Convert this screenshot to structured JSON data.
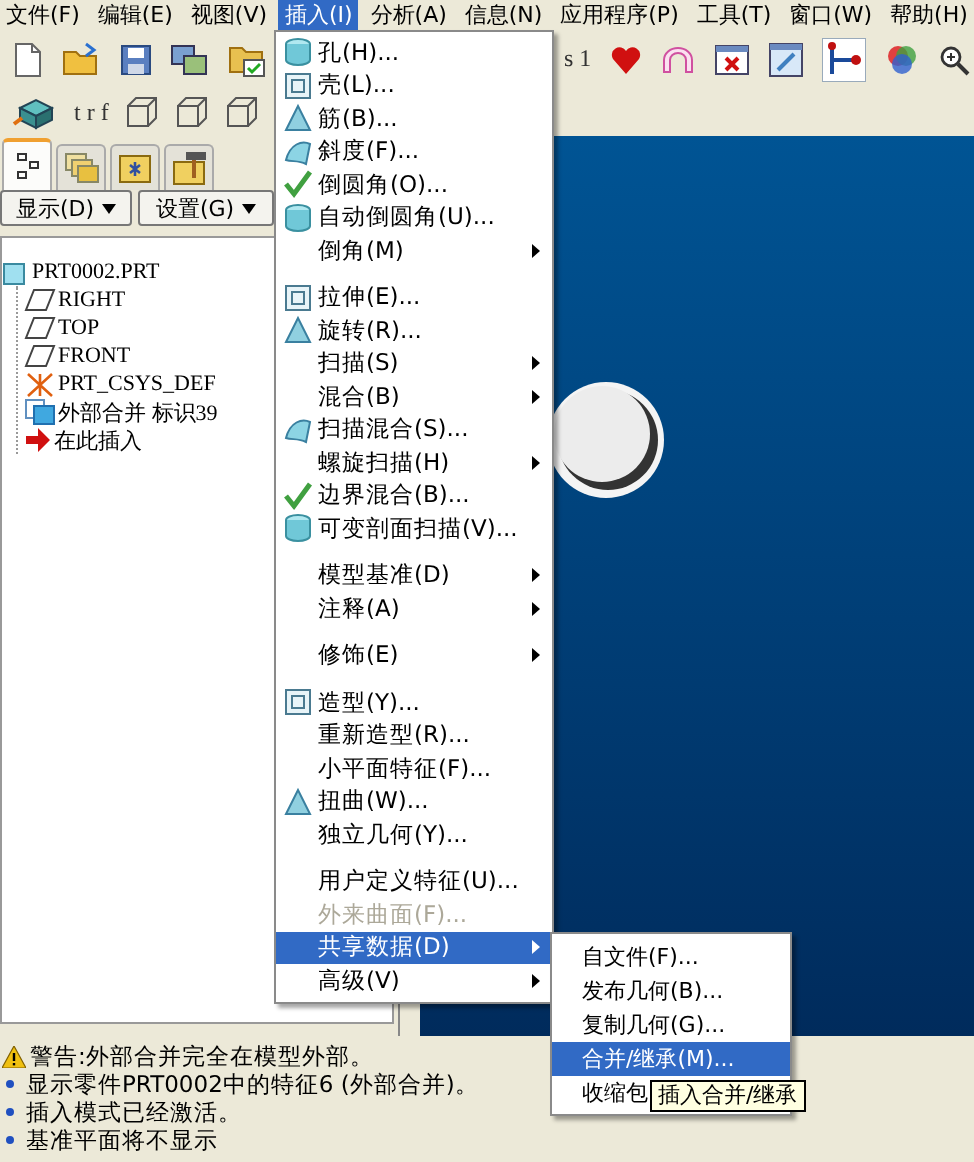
{
  "menubar": [
    {
      "label": "文件(F)",
      "selected": false
    },
    {
      "label": "编辑(E)",
      "selected": false
    },
    {
      "label": "视图(V)",
      "selected": false
    },
    {
      "label": "插入(I)",
      "selected": true
    },
    {
      "label": "分析(A)",
      "selected": false
    },
    {
      "label": "信息(N)",
      "selected": false
    },
    {
      "label": "应用程序(P)",
      "selected": false
    },
    {
      "label": "工具(T)",
      "selected": false
    },
    {
      "label": "窗口(W)",
      "selected": false
    },
    {
      "label": "帮助(H)",
      "selected": false
    }
  ],
  "toolbar_1": {
    "text": "s 1"
  },
  "toolbar_2": {
    "text": "t r f"
  },
  "model_tree": {
    "tabs": [
      {
        "selected": true
      },
      {
        "selected": false
      },
      {
        "selected": false
      },
      {
        "selected": false
      }
    ],
    "buttons": [
      "显示(D)",
      "设置(G)"
    ],
    "root": {
      "label": "PRT0002.PRT",
      "kind": "part",
      "children": [
        {
          "label": "RIGHT",
          "kind": "datum-plane"
        },
        {
          "label": "TOP",
          "kind": "datum-plane"
        },
        {
          "label": "FRONT",
          "kind": "datum-plane"
        },
        {
          "label": "PRT_CSYS_DEF",
          "kind": "csys"
        },
        {
          "label": "外部合并 标识39",
          "kind": "merge"
        },
        {
          "label": "在此插入",
          "kind": "insert"
        }
      ]
    }
  },
  "insert_menu": {
    "groups": [
      {
        "items": [
          {
            "label": "孔(H)...",
            "kind": "action",
            "icon": true,
            "disabled": false,
            "selected": false
          },
          {
            "label": "壳(L)...",
            "kind": "action",
            "icon": true,
            "disabled": false,
            "selected": false
          },
          {
            "label": "筋(B)...",
            "kind": "action",
            "icon": true,
            "disabled": false,
            "selected": false
          },
          {
            "label": "斜度(F)...",
            "kind": "action",
            "icon": true,
            "disabled": false,
            "selected": false
          },
          {
            "label": "倒圆角(O)...",
            "kind": "action",
            "icon": true,
            "disabled": false,
            "selected": false
          },
          {
            "label": "自动倒圆角(U)...",
            "kind": "action",
            "icon": true,
            "disabled": false,
            "selected": false
          },
          {
            "label": "倒角(M)",
            "kind": "submenu",
            "icon": false,
            "disabled": false,
            "selected": false
          }
        ]
      },
      {
        "items": [
          {
            "label": "拉伸(E)...",
            "kind": "action",
            "icon": true,
            "disabled": false,
            "selected": false
          },
          {
            "label": "旋转(R)...",
            "kind": "action",
            "icon": true,
            "disabled": false,
            "selected": false
          },
          {
            "label": "扫描(S)",
            "kind": "submenu",
            "icon": false,
            "disabled": false,
            "selected": false
          },
          {
            "label": "混合(B)",
            "kind": "submenu",
            "icon": false,
            "disabled": false,
            "selected": false
          },
          {
            "label": "扫描混合(S)...",
            "kind": "action",
            "icon": true,
            "disabled": false,
            "selected": false
          },
          {
            "label": "螺旋扫描(H)",
            "kind": "submenu",
            "icon": false,
            "disabled": false,
            "selected": false
          },
          {
            "label": "边界混合(B)...",
            "kind": "action",
            "icon": true,
            "disabled": false,
            "selected": false
          },
          {
            "label": "可变剖面扫描(V)...",
            "kind": "action",
            "icon": true,
            "disabled": false,
            "selected": false
          }
        ]
      },
      {
        "items": [
          {
            "label": "模型基准(D)",
            "kind": "submenu",
            "icon": false,
            "disabled": false,
            "selected": false
          },
          {
            "label": "注释(A)",
            "kind": "submenu",
            "icon": false,
            "disabled": false,
            "selected": false
          }
        ]
      },
      {
        "items": [
          {
            "label": "修饰(E)",
            "kind": "submenu",
            "icon": false,
            "disabled": false,
            "selected": false
          }
        ]
      },
      {
        "items": [
          {
            "label": "造型(Y)...",
            "kind": "action",
            "icon": true,
            "disabled": false,
            "selected": false
          },
          {
            "label": "重新造型(R)...",
            "kind": "action",
            "icon": false,
            "disabled": false,
            "selected": false
          },
          {
            "label": "小平面特征(F)...",
            "kind": "action",
            "icon": false,
            "disabled": false,
            "selected": false
          },
          {
            "label": "扭曲(W)...",
            "kind": "action",
            "icon": true,
            "disabled": false,
            "selected": false
          },
          {
            "label": "独立几何(Y)...",
            "kind": "action",
            "icon": false,
            "disabled": false,
            "selected": false
          }
        ]
      },
      {
        "items": [
          {
            "label": "用户定义特征(U)...",
            "kind": "action",
            "icon": false,
            "disabled": false,
            "selected": false
          },
          {
            "label": "外来曲面(F)...",
            "kind": "action",
            "icon": false,
            "disabled": true,
            "selected": false
          },
          {
            "label": "共享数据(D)",
            "kind": "submenu",
            "icon": false,
            "disabled": false,
            "selected": true
          },
          {
            "label": "高级(V)",
            "kind": "submenu",
            "icon": false,
            "disabled": false,
            "selected": false
          }
        ]
      }
    ]
  },
  "shared_data_submenu": {
    "items": [
      {
        "label": "自文件(F)...",
        "selected": false
      },
      {
        "label": "发布几何(B)...",
        "selected": false
      },
      {
        "label": "复制几何(G)...",
        "selected": false
      },
      {
        "label": "合并/继承(M)...",
        "selected": true
      },
      {
        "label": "收缩包",
        "selected": false
      }
    ]
  },
  "tooltip": "插入合并/继承",
  "messages": [
    {
      "kind": "warning",
      "text": "警告:外部合并完全在模型外部。"
    },
    {
      "kind": "info",
      "text": "显示零件PRT0002中的特征6 (外部合并)。"
    },
    {
      "kind": "info",
      "text": "插入模式已经激活。"
    },
    {
      "kind": "info",
      "text": "基准平面将不显示"
    }
  ]
}
